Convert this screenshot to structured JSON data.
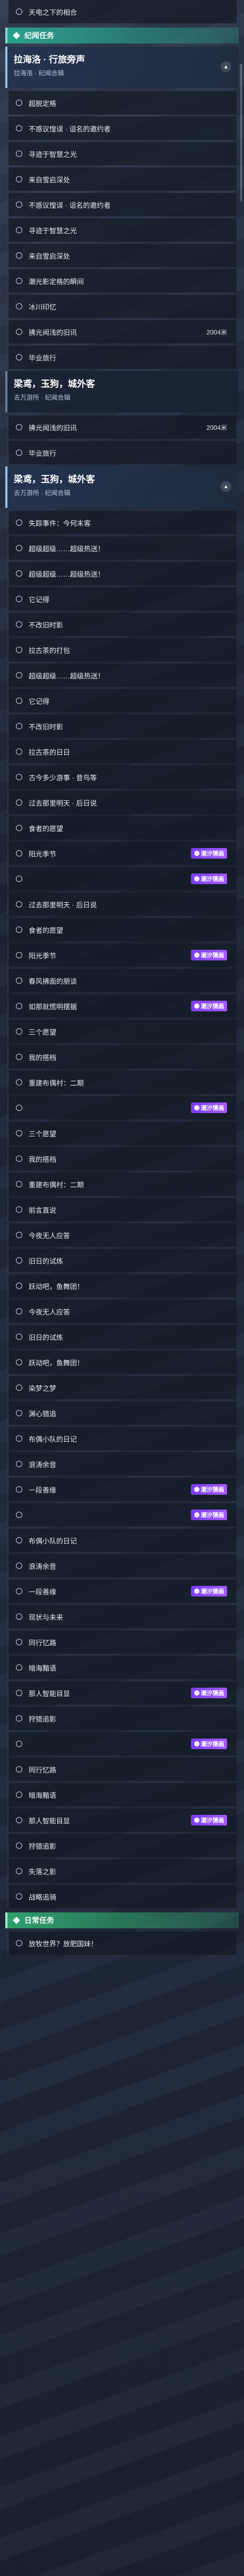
{
  "sections": [
    {
      "type": "row",
      "label": "天电之下的相合"
    },
    {
      "type": "header",
      "label": "纪闻任务"
    },
    {
      "type": "quest",
      "title": "拉海洛 · 行旅旁声",
      "sub": "拉海洛 · 纪闻合辑",
      "active": true
    },
    {
      "type": "row",
      "label": "超脱定格"
    },
    {
      "type": "row",
      "label": "不惑议惶误 · 诅名的邀约者"
    },
    {
      "type": "row",
      "label": "寻迹于智慧之光"
    },
    {
      "type": "row",
      "label": "来自雪启深处"
    },
    {
      "type": "row",
      "label": "不惑议惶误 · 诅名的邀约者"
    },
    {
      "type": "row",
      "label": "寻迹于智慧之光"
    },
    {
      "type": "row",
      "label": "来自雪启深处"
    },
    {
      "type": "row",
      "label": "潮光影定格的瞬间"
    },
    {
      "type": "row",
      "label": "冰川印忆"
    },
    {
      "type": "row",
      "label": "拂光闻浅的旧讯",
      "dist": "2004米"
    },
    {
      "type": "row",
      "label": "毕业旅行"
    },
    {
      "type": "quest",
      "title": "梁鸢，玉狗，城外客",
      "sub": "去万游所 · 纪闻合辑",
      "active": false
    },
    {
      "type": "row",
      "label": "拂光闻浅的旧讯",
      "dist": "2004米"
    },
    {
      "type": "row",
      "label": "毕业旅行"
    },
    {
      "type": "quest",
      "title": "梁鸢，玉狗，城外客",
      "sub": "去万游所 · 纪闻合辑",
      "active": true
    },
    {
      "type": "row",
      "label": "失踪事件：今何末客"
    },
    {
      "type": "row",
      "label": "超级超级……超级热送！"
    },
    {
      "type": "row",
      "label": "超级超级……超级热送！"
    },
    {
      "type": "row",
      "label": "它记得"
    },
    {
      "type": "row",
      "label": "不改旧时影"
    },
    {
      "type": "row",
      "label": "拉古茶的打包"
    },
    {
      "type": "row",
      "label": "超级超级……超级热送！"
    },
    {
      "type": "row",
      "label": "它记得"
    },
    {
      "type": "row",
      "label": "不改旧时影"
    },
    {
      "type": "row",
      "label": "拉古茶的日日"
    },
    {
      "type": "row",
      "label": "古今多少游事 · 昔鸟等"
    },
    {
      "type": "row",
      "label": "过去那里明天 · 后日说"
    },
    {
      "type": "row",
      "label": "食者的愿望"
    },
    {
      "type": "row",
      "label": "阳光季节",
      "tag": "潮汐猜画"
    },
    {
      "type": "row",
      "label": "",
      "tag": "潮汐猜画"
    },
    {
      "type": "row",
      "label": "过去那里明天 · 后日说"
    },
    {
      "type": "row",
      "label": "食者的愿望"
    },
    {
      "type": "row",
      "label": "阳光季节",
      "tag": "潮汐猜画"
    },
    {
      "type": "row",
      "label": "春风拂面的朋谈"
    },
    {
      "type": "row",
      "label": "如那就慌明摆据",
      "tag": "潮汐猜画"
    },
    {
      "type": "row",
      "label": "三个愿望"
    },
    {
      "type": "row",
      "label": "我的搭档"
    },
    {
      "type": "row",
      "label": "重建布偶村：二期"
    },
    {
      "type": "row",
      "label": "",
      "tag": "潮汐猜画"
    },
    {
      "type": "row",
      "label": "三个愿望"
    },
    {
      "type": "row",
      "label": "我的搭档"
    },
    {
      "type": "row",
      "label": "重建布偶村：二期"
    },
    {
      "type": "row",
      "label": "前言直说"
    },
    {
      "type": "row",
      "label": "今夜无人应答"
    },
    {
      "type": "row",
      "label": "旧日的试炼"
    },
    {
      "type": "row",
      "label": "跃动吧，鱼舞团！"
    },
    {
      "type": "row",
      "label": "今夜无人应答"
    },
    {
      "type": "row",
      "label": "旧日的试炼"
    },
    {
      "type": "row",
      "label": "跃动吧，鱼舞团！"
    },
    {
      "type": "row",
      "label": "染梦之梦"
    },
    {
      "type": "row",
      "label": "渊心猎追"
    },
    {
      "type": "row",
      "label": "布偶小队的日记"
    },
    {
      "type": "row",
      "label": "浪涛余音"
    },
    {
      "type": "row",
      "label": "一段善缘",
      "tag": "潮汐猜画"
    },
    {
      "type": "row",
      "label": "",
      "tag": "潮汐猜画"
    },
    {
      "type": "row",
      "label": "布偶小队的日记"
    },
    {
      "type": "row",
      "label": "浪涛余音"
    },
    {
      "type": "row",
      "label": "一段善缘",
      "tag": "潮汐猜画"
    },
    {
      "type": "row",
      "label": "现状与未来"
    },
    {
      "type": "row",
      "label": "同行忆路"
    },
    {
      "type": "row",
      "label": "暗海黯语"
    },
    {
      "type": "row",
      "label": "那人智能目显",
      "tag": "潮汐猜画"
    },
    {
      "type": "row",
      "label": "狩猎追影"
    },
    {
      "type": "row",
      "label": "",
      "tag": "潮汐猜画"
    },
    {
      "type": "row",
      "label": "同行忆路"
    },
    {
      "type": "row",
      "label": "暗海黯语"
    },
    {
      "type": "row",
      "label": "那人智能目显",
      "tag": "潮汐猜画"
    },
    {
      "type": "row",
      "label": "狩猎追影"
    },
    {
      "type": "row",
      "label": "失落之影"
    },
    {
      "type": "row",
      "label": "战略追骑"
    },
    {
      "type": "header",
      "label": "日常任务",
      "daily": true
    },
    {
      "type": "row",
      "label": "放牧世界？放肥国妹！"
    }
  ]
}
